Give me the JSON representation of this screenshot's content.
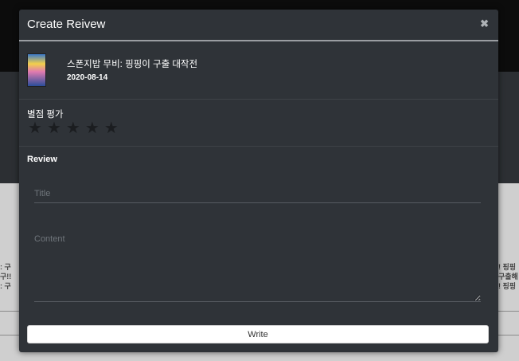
{
  "modal": {
    "title": "Create Reivew",
    "close_icon": "close-icon",
    "close_glyph": "✖"
  },
  "movie": {
    "title": "스폰지밥 무비: 핑핑이 구출 대작전",
    "release_date": "2020-08-14",
    "poster": "movie-poster-image"
  },
  "rating": {
    "label": "별점 평가",
    "max_stars": 5,
    "value": 0,
    "star_glyph": "★"
  },
  "review": {
    "label": "Review",
    "title_placeholder": "Title",
    "content_placeholder": "Content"
  },
  "actions": {
    "write_label": "Write"
  },
  "colors": {
    "modal_bg": "#2f3338",
    "star_empty": "#1b1d20",
    "button_bg": "#ffffff"
  }
}
